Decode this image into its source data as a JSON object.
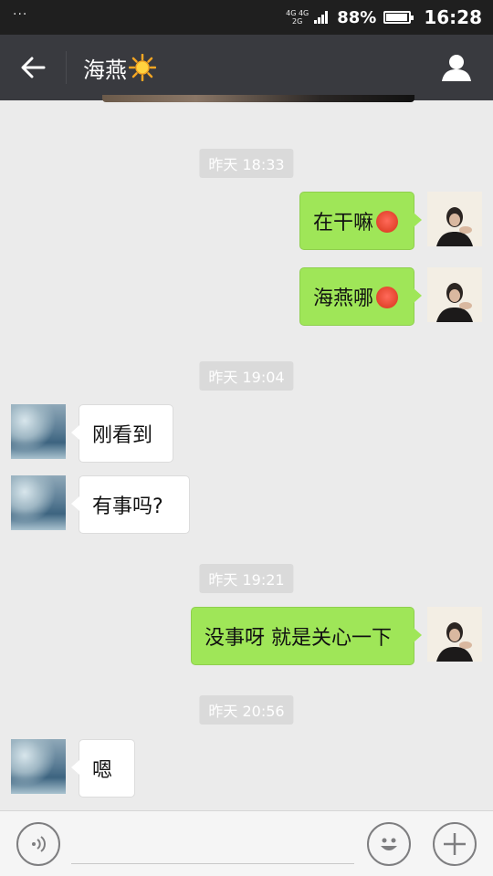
{
  "status_bar": {
    "dots": "···",
    "network_top": "4G 4G",
    "network_bottom": "2G",
    "battery": "88%",
    "battery_level": 0.88,
    "time": "16:28"
  },
  "header": {
    "title": "海燕",
    "title_emoji": "☀️",
    "back_icon": "arrow-left-icon",
    "profile_icon": "person-icon"
  },
  "messages": [
    {
      "type": "timestamp",
      "text": "昨天 18:33"
    },
    {
      "type": "message",
      "sender": "me",
      "text": "在干嘛",
      "emoji": "blush-emoji"
    },
    {
      "type": "message",
      "sender": "me",
      "text": "海燕哪",
      "emoji": "blush-emoji"
    },
    {
      "type": "timestamp",
      "text": "昨天 19:04"
    },
    {
      "type": "message",
      "sender": "friend",
      "text": "刚看到"
    },
    {
      "type": "message",
      "sender": "friend",
      "text": "有事吗?"
    },
    {
      "type": "timestamp",
      "text": "昨天 19:21"
    },
    {
      "type": "message",
      "sender": "me",
      "text": "没事呀 就是关心一下"
    },
    {
      "type": "timestamp",
      "text": "昨天 20:56"
    },
    {
      "type": "message",
      "sender": "friend",
      "text": "嗯"
    }
  ],
  "input_bar": {
    "voice_icon": "voice-icon",
    "text_value": "",
    "emoji_icon": "emoji-icon",
    "plus_icon": "plus-icon"
  },
  "colors": {
    "status_bar": "#1f1f1f",
    "title_bar": "#393a3f",
    "chat_background": "#ebebeb",
    "my_bubble": "#9fe658",
    "friend_bubble": "#ffffff",
    "timestamp_chip": "#dadada"
  }
}
